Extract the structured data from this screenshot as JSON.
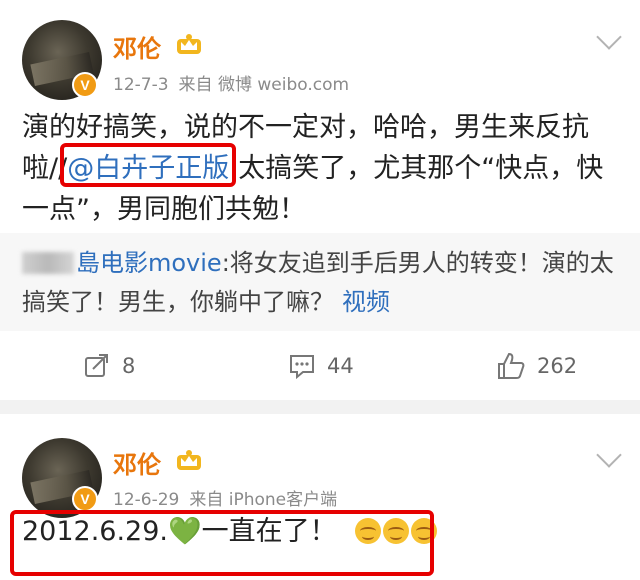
{
  "posts": [
    {
      "username": "邓伦",
      "date": "12-7-3",
      "source": "来自 微博 weibo.com",
      "badge": "V",
      "text_part1": "演的好搞笑，说的不一定对，哈哈，男生来反抗啦//",
      "mention": "@白卉子正版",
      "text_part2": ":太搞笑了，尤其那个“快点，快一点”，男同胞们共勉！",
      "repost": {
        "name_suffix": "島电影movie",
        "text": ":将女友追到手后男人的转变！演的太搞笑了！男生，你躺中了嘛？",
        "link": "视频"
      },
      "actions": {
        "repost_count": "8",
        "comment_count": "44",
        "like_count": "262"
      }
    },
    {
      "username": "邓伦",
      "date": "12-6-29",
      "source": "来自 iPhone客户端",
      "badge": "V",
      "text": "2012.6.29.",
      "heart": "💚",
      "text_after": "一直在了！"
    }
  ],
  "colors": {
    "username": "#e8760c",
    "link": "#2f6fbd",
    "highlight_border": "#e60000",
    "heart": "#7dc242"
  }
}
